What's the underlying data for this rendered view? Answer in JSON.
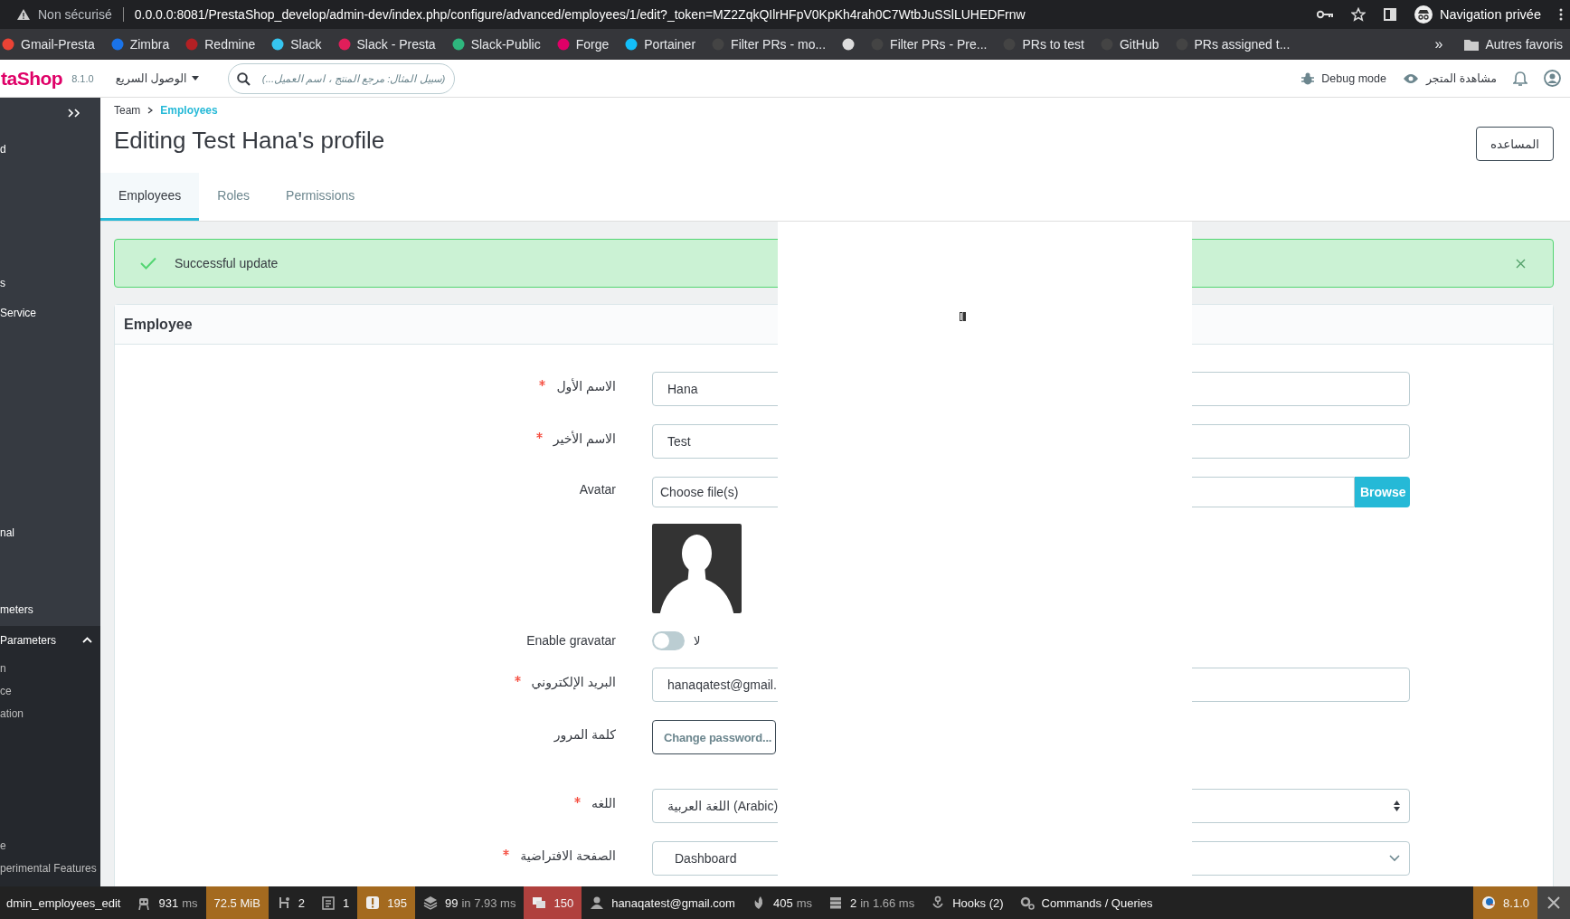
{
  "browser": {
    "warning": "Non sécurisé",
    "url": "0.0.0.0:8081/PrestaShop_develop/admin-dev/index.php/configure/advanced/employees/1/edit?_token=MZ2ZqkQIlrHFpV0KpKh4rah0C7WtbJuSSlLUHEDFrnw",
    "profile": "Navigation privée"
  },
  "bookmarks": [
    {
      "label": "Gmail-Presta",
      "color": "#ea4335"
    },
    {
      "label": "Zimbra",
      "color": "#1a73e8"
    },
    {
      "label": "Redmine",
      "color": "#b32024"
    },
    {
      "label": "Slack",
      "color": "#36c5f0"
    },
    {
      "label": "Slack - Presta",
      "color": "#e01e5a"
    },
    {
      "label": "Slack-Public",
      "color": "#2eb67d"
    },
    {
      "label": "Forge",
      "color": "#df0067"
    },
    {
      "label": "Portainer",
      "color": "#13bef9"
    },
    {
      "label": "Filter PRs - mo...",
      "color": "#444444"
    },
    {
      "color": "#dddddd"
    },
    {
      "label": "Filter PRs - Pre...",
      "color": "#444444"
    },
    {
      "label": "PRs to test",
      "color": "#444444"
    },
    {
      "label": "GitHub",
      "color": "#444444"
    },
    {
      "label": "PRs assigned t...",
      "color": "#444444"
    }
  ],
  "bookmarks_more": "»",
  "bookmarks_folder": "Autres favoris",
  "header": {
    "logo": "taShop",
    "version": "8.1.0",
    "quick_access": "الوصول السريع",
    "search_placeholder": "(سبيل المثال: مرجع المنتج ، اسم العميل...)",
    "debug": "Debug mode",
    "view_store": "مشاهدة المتجر"
  },
  "sidebar": {
    "items": [
      {
        "label": "d"
      },
      {
        "label": "s"
      },
      {
        "label": "Service"
      },
      {
        "label": "nal"
      },
      {
        "label": "meters"
      }
    ],
    "section": {
      "label": "Parameters",
      "expanded": true,
      "children": [
        {
          "label": "n"
        },
        {
          "label": "ce"
        },
        {
          "label": "ation"
        },
        {
          "label": "e"
        },
        {
          "label": "perimental Features"
        }
      ]
    }
  },
  "breadcrumb": [
    "Team",
    "Employees"
  ],
  "title": "Editing Test Hana's profile",
  "help_button": "المساعده",
  "tabs": [
    {
      "label": "Employees",
      "selected": true
    },
    {
      "label": "Roles",
      "selected": false
    },
    {
      "label": "Permissions",
      "selected": false
    }
  ],
  "alert": {
    "message": "Successful update"
  },
  "card": {
    "title": "Employee",
    "rows": [
      {
        "kind": "text",
        "label": "الاسم الأول",
        "required": true,
        "value": "Hana"
      },
      {
        "kind": "text",
        "label": "الاسم الأخير",
        "required": true,
        "value": "Test"
      },
      {
        "kind": "file",
        "label": "Avatar",
        "required": false,
        "value": "Choose file(s)",
        "button": "Browse"
      },
      {
        "kind": "image"
      },
      {
        "kind": "switch",
        "label": "Enable gravatar",
        "on": false,
        "state_label": "لا"
      },
      {
        "kind": "text",
        "label": "البريد الإلكتروني",
        "required": true,
        "value": "hanaqatest@gmail."
      },
      {
        "kind": "button",
        "label": "كلمة المرور",
        "required": false,
        "value": "Change password..."
      },
      {
        "kind": "select",
        "label": "اللغه",
        "required": true,
        "value": "اللغة العربية (Arabic)"
      },
      {
        "kind": "dropdown",
        "label": "الصفحة الافتراضية",
        "required": true,
        "value": "Dashboard"
      }
    ]
  },
  "debug_toolbar": [
    {
      "value": "dmin_employees_edit"
    },
    {
      "value": "931",
      "detail": "ms"
    },
    {
      "value": "72.5 MiB",
      "color": "#a46a1f"
    },
    {
      "value": "2"
    },
    {
      "value": "1"
    },
    {
      "value": "195",
      "color": "#a46a1f"
    },
    {
      "value": "99",
      "detail": "in 7.93 ms"
    },
    {
      "value": "150",
      "color": "#b0413e"
    },
    {
      "value": "hanaqatest@gmail.com"
    },
    {
      "value": "405",
      "detail": "ms"
    },
    {
      "value": "2",
      "detail": "in 1.66 ms"
    },
    {
      "value": "Hooks (2)"
    },
    {
      "value": "Commands / Queries"
    },
    {
      "value": "8.1.0",
      "color": "#a46a1f"
    }
  ]
}
